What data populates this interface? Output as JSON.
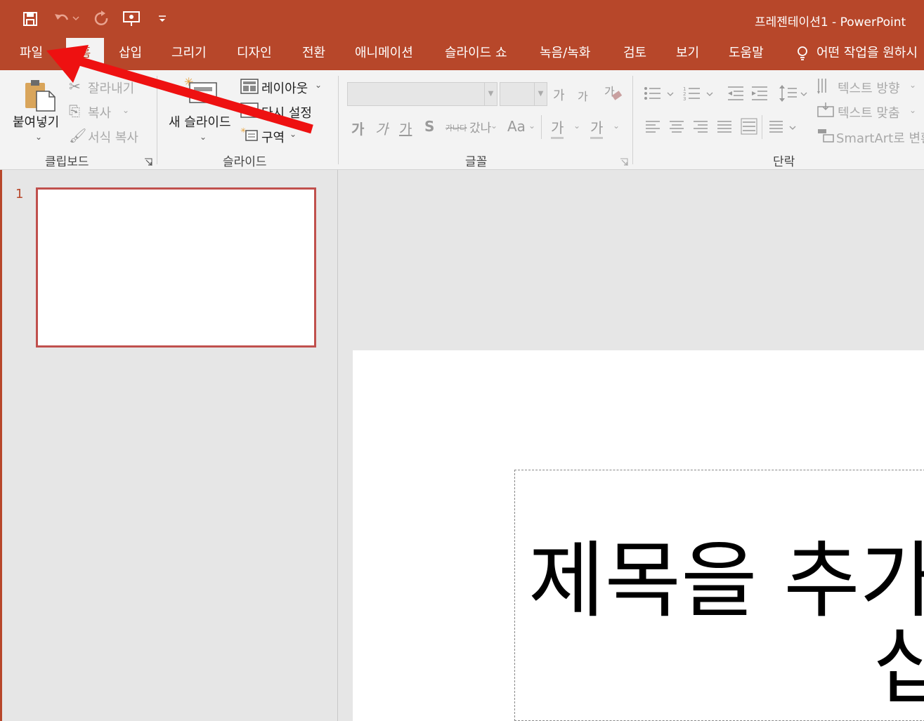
{
  "window": {
    "doc_title": "프레젠테이션1  -  PowerPoint"
  },
  "quick_access": [
    "save-icon",
    "undo-icon",
    "redo-icon",
    "present-from-start-icon",
    "customize-qat-icon"
  ],
  "tabs": [
    {
      "label": "파일",
      "active": false
    },
    {
      "label": "홈",
      "active": true
    },
    {
      "label": "삽입",
      "active": false
    },
    {
      "label": "그리기",
      "active": false
    },
    {
      "label": "디자인",
      "active": false
    },
    {
      "label": "전환",
      "active": false
    },
    {
      "label": "애니메이션",
      "active": false
    },
    {
      "label": "슬라이드 쇼",
      "active": false
    },
    {
      "label": "녹음/녹화",
      "active": false
    },
    {
      "label": "검토",
      "active": false
    },
    {
      "label": "보기",
      "active": false
    },
    {
      "label": "도움말",
      "active": false
    }
  ],
  "tell_me": "어떤 작업을 원하시",
  "ribbon": {
    "clipboard": {
      "label": "클립보드",
      "paste": "붙여넣기",
      "cut": "잘라내기",
      "copy": "복사",
      "format_painter": "서식 복사"
    },
    "slides": {
      "label": "슬라이드",
      "new_slide": "새 슬라이드",
      "layout": "레이아웃",
      "reset": "다시 설정",
      "section": "구역"
    },
    "font": {
      "label": "글꼴",
      "grow": "가",
      "shrink": "가",
      "bold": "가",
      "italic": "가",
      "underline": "가",
      "shadow": "S",
      "strikethrough": "가나다",
      "spacing": "갔나",
      "case": "Aa",
      "highlight": "가",
      "font_color": "가"
    },
    "paragraph": {
      "label": "단락",
      "text_direction": "텍스트 방향",
      "align_text": "텍스트 맞춤",
      "smartart": "SmartArt로 변환"
    }
  },
  "slides_pane": {
    "slide_number": "1"
  },
  "slide": {
    "title_line1": "제목을 추가",
    "title_line2": "십"
  },
  "colors": {
    "accent": "#b7472a",
    "ribbon_bg": "#f3f3f3",
    "thumb_border": "#c0504d",
    "annotation_arrow": "#ee1111"
  }
}
